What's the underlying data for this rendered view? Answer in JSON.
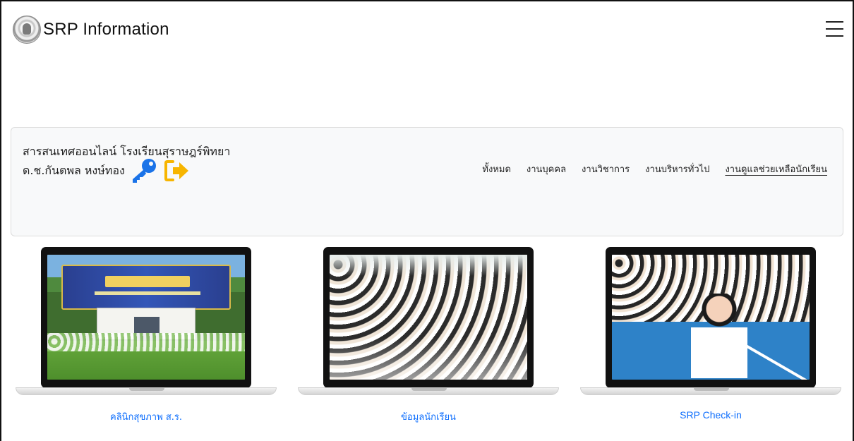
{
  "header": {
    "brand_text": "SRP Information",
    "logo_icon": "school-emblem-icon",
    "menu_icon": "hamburger-menu-icon"
  },
  "panel": {
    "school_name": "สารสนเทศออนไลน์ โรงเรียนสุราษฎร์พิทยา",
    "user_name": "ด.ช.กันตพล หงษ์ทอง",
    "key_icon": "key-icon",
    "logout_icon": "sign-out-icon",
    "nav": [
      {
        "label": "ทั้งหมด",
        "active": false
      },
      {
        "label": "งานบุคคล",
        "active": false
      },
      {
        "label": "งานวิชาการ",
        "active": false
      },
      {
        "label": "งานบริหารทั่วไป",
        "active": false
      },
      {
        "label": "งานดูแลช่วยเหลือนักเรียน",
        "active": true
      }
    ]
  },
  "cards": [
    {
      "title": "คลินิกสุขภาพ ส.ร."
    },
    {
      "title": "ข้อมูลนักเรียน"
    },
    {
      "title": "SRP Check-in"
    }
  ],
  "colors": {
    "link": "#0d6efd",
    "key_icon": "#1a73e8",
    "logout_icon": "#f7b500",
    "panel_bg": "#f8f9fa"
  }
}
